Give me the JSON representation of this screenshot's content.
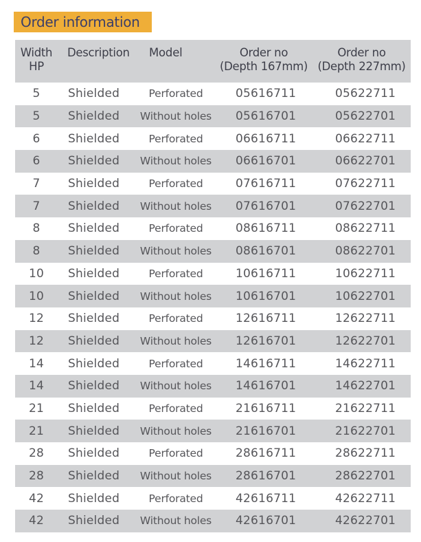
{
  "title": "Order information",
  "colors": {
    "title_bg": "#efae38",
    "title_text": "#3c3f69",
    "stripe": "#d1d2d4",
    "text": "#56565a"
  },
  "table": {
    "headers": {
      "width": [
        "Width",
        "HP"
      ],
      "description": "Description",
      "model": "Model",
      "order_167": [
        "Order no",
        "(Depth 167mm)"
      ],
      "order_227": [
        "Order no",
        "(Depth 227mm)"
      ]
    },
    "rows": [
      {
        "width": "5",
        "description": "Shielded",
        "model": "Perforated",
        "order_167": "05616711",
        "order_227": "05622711"
      },
      {
        "width": "5",
        "description": "Shielded",
        "model": "Without holes",
        "order_167": "05616701",
        "order_227": "05622701"
      },
      {
        "width": "6",
        "description": "Shielded",
        "model": "Perforated",
        "order_167": "06616711",
        "order_227": "06622711"
      },
      {
        "width": "6",
        "description": "Shielded",
        "model": "Without holes",
        "order_167": "06616701",
        "order_227": "06622701"
      },
      {
        "width": "7",
        "description": "Shielded",
        "model": "Perforated",
        "order_167": "07616711",
        "order_227": "07622711"
      },
      {
        "width": "7",
        "description": "Shielded",
        "model": "Without holes",
        "order_167": "07616701",
        "order_227": "07622701"
      },
      {
        "width": "8",
        "description": "Shielded",
        "model": "Perforated",
        "order_167": "08616711",
        "order_227": "08622711"
      },
      {
        "width": "8",
        "description": "Shielded",
        "model": "Without holes",
        "order_167": "08616701",
        "order_227": "08622701"
      },
      {
        "width": "10",
        "description": "Shielded",
        "model": "Perforated",
        "order_167": "10616711",
        "order_227": "10622711"
      },
      {
        "width": "10",
        "description": "Shielded",
        "model": "Without holes",
        "order_167": "10616701",
        "order_227": "10622701"
      },
      {
        "width": "12",
        "description": "Shielded",
        "model": "Perforated",
        "order_167": "12616711",
        "order_227": "12622711"
      },
      {
        "width": "12",
        "description": "Shielded",
        "model": "Without holes",
        "order_167": "12616701",
        "order_227": "12622701"
      },
      {
        "width": "14",
        "description": "Shielded",
        "model": "Perforated",
        "order_167": "14616711",
        "order_227": "14622711"
      },
      {
        "width": "14",
        "description": "Shielded",
        "model": "Without holes",
        "order_167": "14616701",
        "order_227": "14622701"
      },
      {
        "width": "21",
        "description": "Shielded",
        "model": "Perforated",
        "order_167": "21616711",
        "order_227": "21622711"
      },
      {
        "width": "21",
        "description": "Shielded",
        "model": "Without holes",
        "order_167": "21616701",
        "order_227": "21622701"
      },
      {
        "width": "28",
        "description": "Shielded",
        "model": "Perforated",
        "order_167": "28616711",
        "order_227": "28622711"
      },
      {
        "width": "28",
        "description": "Shielded",
        "model": "Without holes",
        "order_167": "28616701",
        "order_227": "28622701"
      },
      {
        "width": "42",
        "description": "Shielded",
        "model": "Perforated",
        "order_167": "42616711",
        "order_227": "42622711"
      },
      {
        "width": "42",
        "description": "Shielded",
        "model": "Without holes",
        "order_167": "42616701",
        "order_227": "42622701"
      }
    ]
  }
}
